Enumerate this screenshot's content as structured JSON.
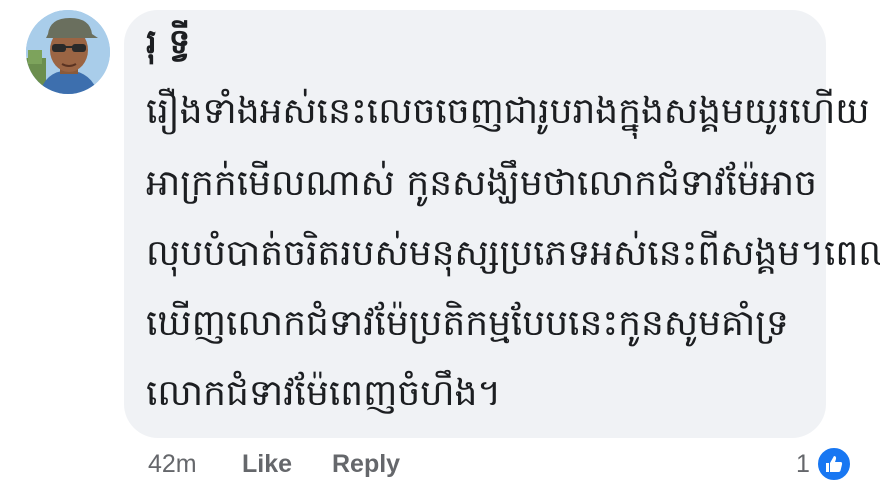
{
  "comment": {
    "author": "រុ ទ្វី",
    "lines": [
      "រឿងទាំងអស់នេះលេចចេញជារូបរាងក្នុងសង្គមយូរហើយ",
      "អាក្រក់មើលណាស់ កូនសង្ឃឹមថាលោកជំទាវម៉ែអាច",
      "លុបបំបាត់ចរិតរបស់មនុស្សប្រភេទអស់នេះពីសង្គម។ពេល",
      "ឃើញលោកជំទាវម៉ែប្រតិកម្មបែបនេះកូនសូមគាំទ្រ",
      "លោកជំទាវម៉ែពេញចំហឹង។"
    ]
  },
  "actions": {
    "time": "42m",
    "like_label": "Like",
    "reply_label": "Reply"
  },
  "reactions": {
    "count": "1",
    "icon": "thumbs-up-icon",
    "color": "#1877f2"
  },
  "colors": {
    "bubble": "#f0f2f5",
    "text": "#1c1e21",
    "meta": "#65676b"
  }
}
